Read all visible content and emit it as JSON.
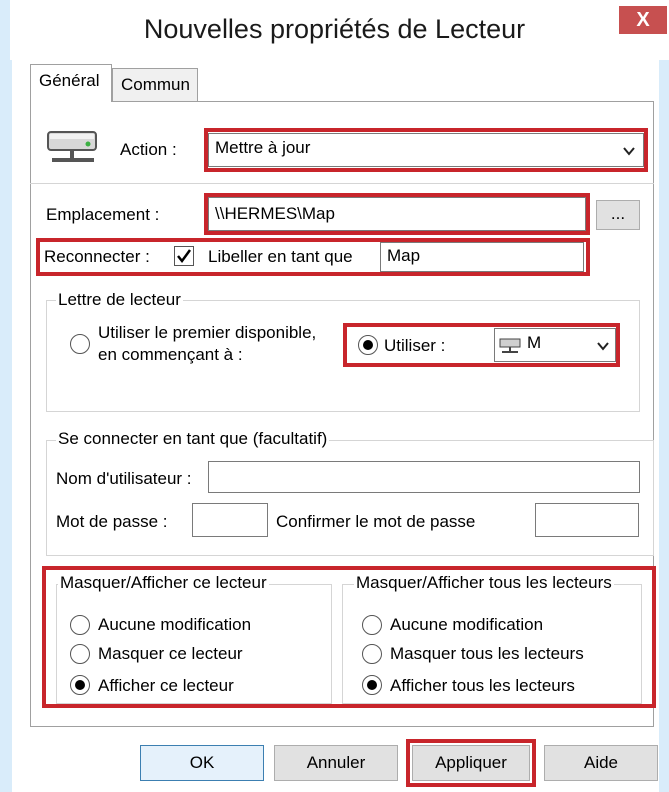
{
  "window": {
    "title": "Nouvelles propriétés de Lecteur",
    "close_glyph": "X"
  },
  "tabs": [
    {
      "label": "Général"
    },
    {
      "label": "Commun"
    }
  ],
  "action": {
    "label": "Action :",
    "value": "Mettre à jour"
  },
  "location": {
    "label": "Emplacement :",
    "value": "\\\\HERMES\\Map",
    "browse_label": "..."
  },
  "reconnect": {
    "label": "Reconnecter :",
    "checked": true,
    "label_as": "Libeller en tant que",
    "label_value": "Map"
  },
  "drive_letter": {
    "legend": "Lettre de lecteur",
    "first_available_line1": "Utiliser le premier disponible,",
    "first_available_line2": "en commençant à :",
    "use_label": "Utiliser :",
    "letter": "M"
  },
  "connect_as": {
    "legend": "Se connecter en tant que (facultatif)",
    "username_label": "Nom d'utilisateur :",
    "username_value": "",
    "password_label": "Mot de passe :",
    "password_value": "",
    "confirm_label": "Confirmer le mot de passe",
    "confirm_value": ""
  },
  "hide_this": {
    "legend": "Masquer/Afficher ce lecteur",
    "options": [
      "Aucune modification",
      "Masquer ce lecteur",
      "Afficher ce lecteur"
    ],
    "selected": "Afficher ce lecteur"
  },
  "hide_all": {
    "legend": "Masquer/Afficher tous les lecteurs",
    "options": [
      "Aucune modification",
      "Masquer tous les lecteurs",
      "Afficher tous les lecteurs"
    ],
    "selected": "Afficher tous les lecteurs"
  },
  "buttons": {
    "ok": "OK",
    "cancel": "Annuler",
    "apply": "Appliquer",
    "help": "Aide"
  },
  "colors": {
    "highlight": "#c8252b",
    "frame": "#d9ecfa",
    "close": "#c75050"
  }
}
